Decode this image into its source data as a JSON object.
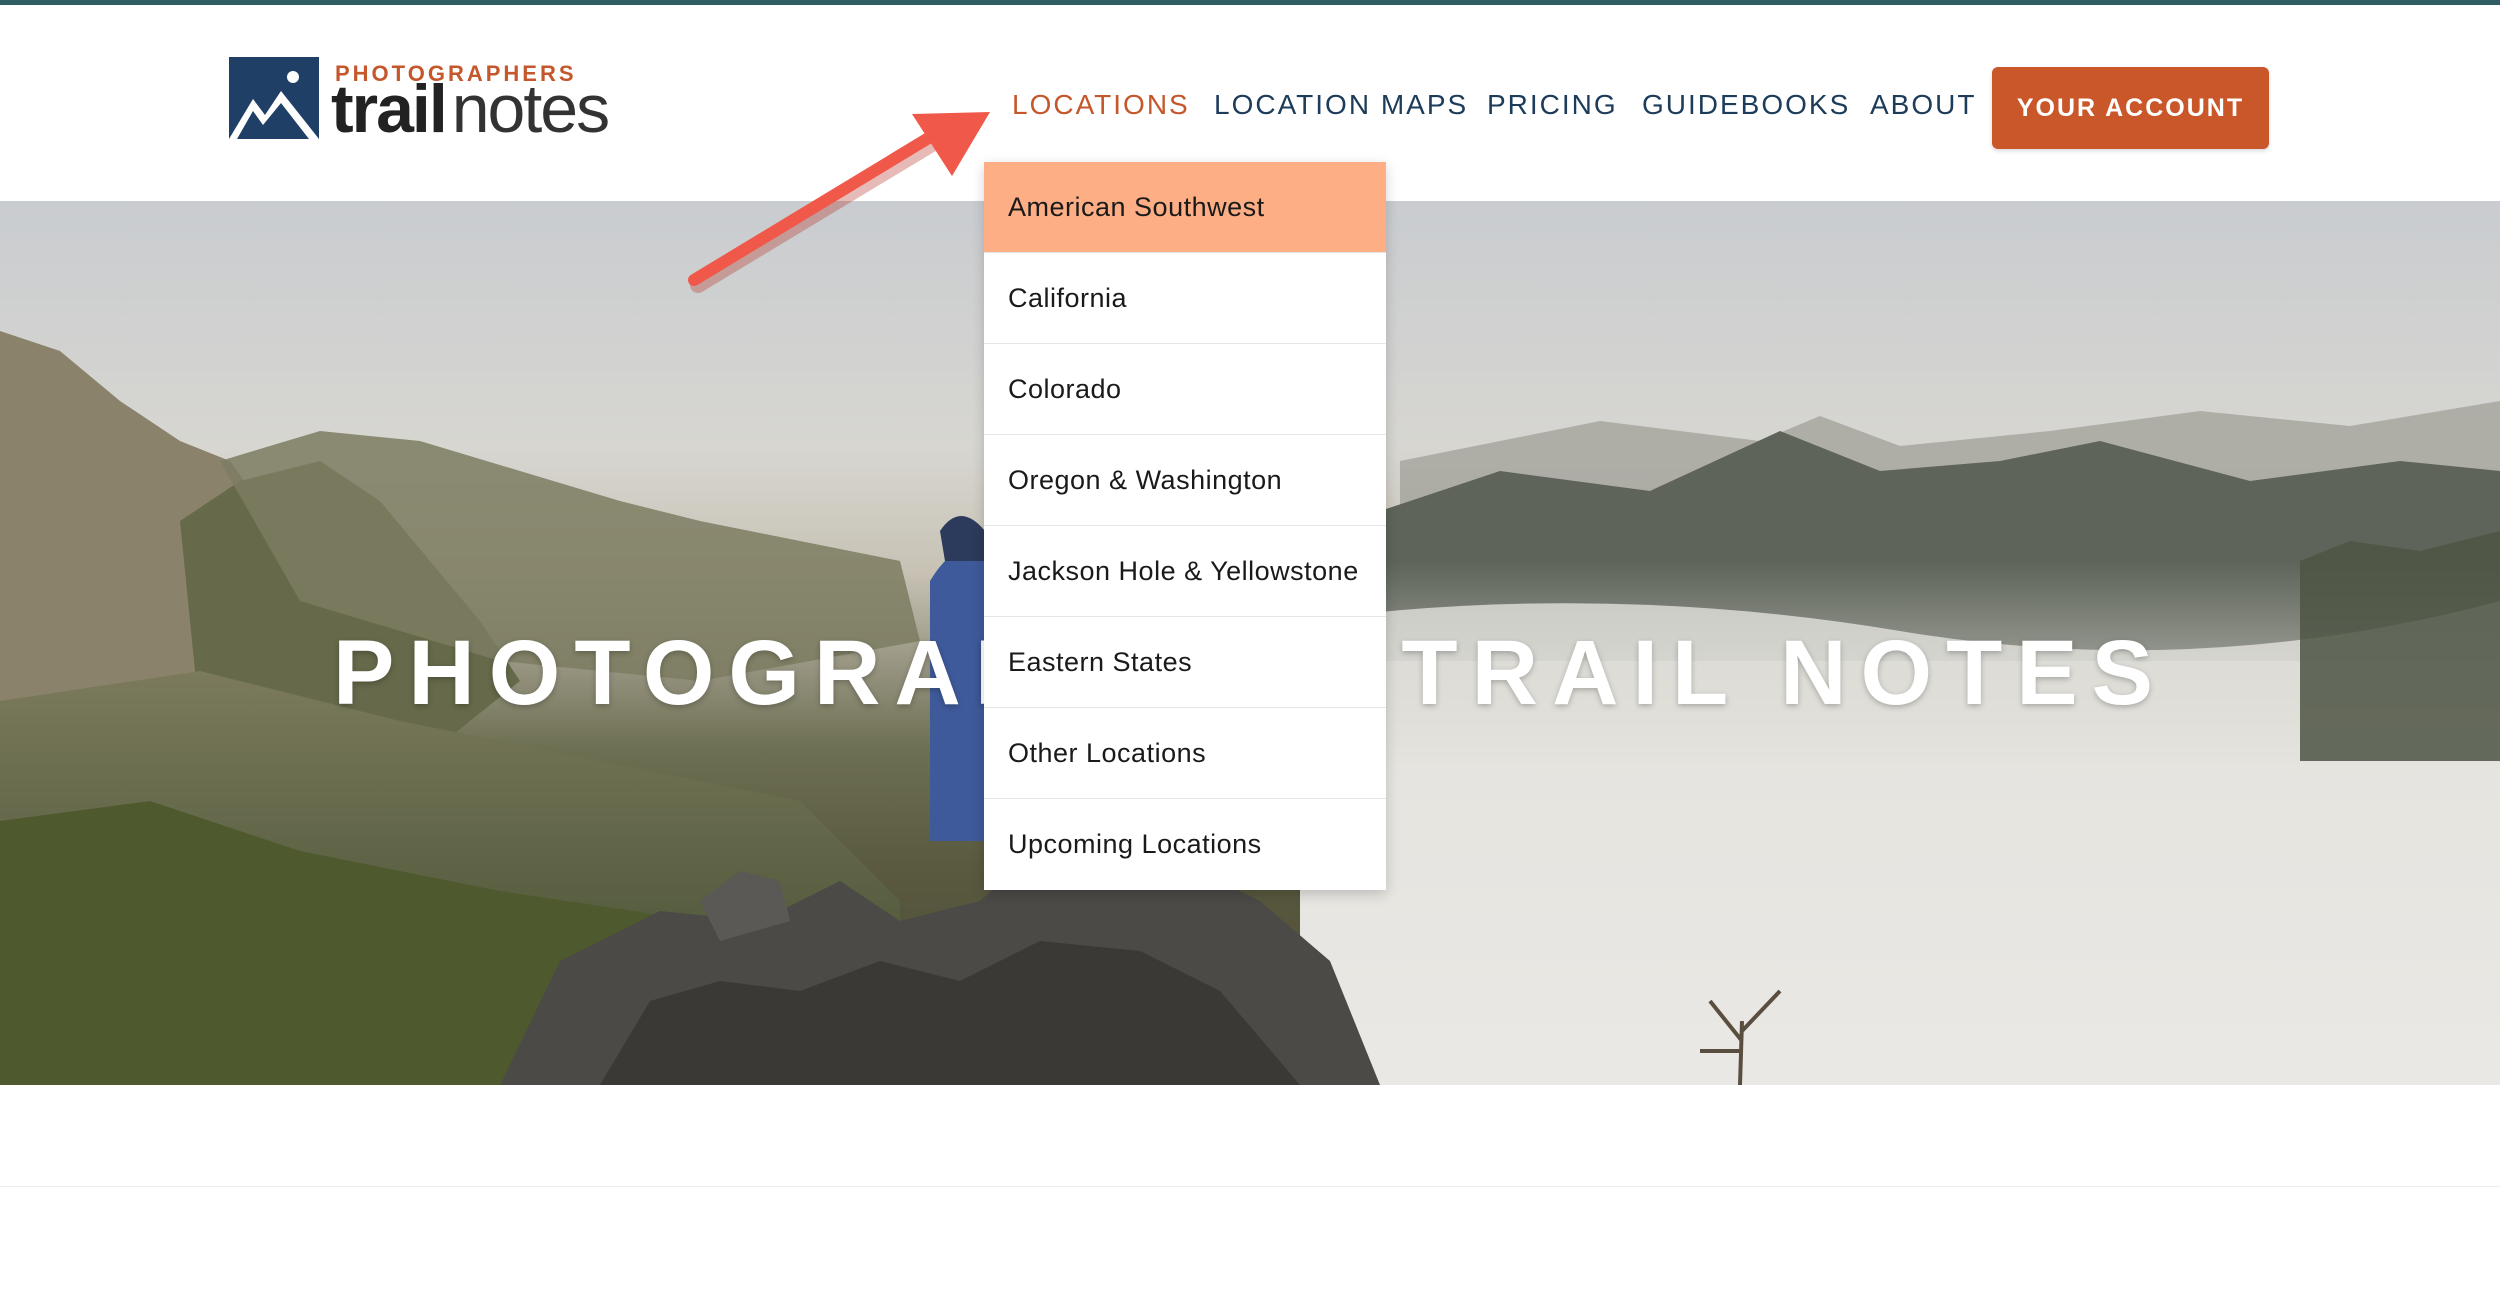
{
  "logo": {
    "top_text": "PHOTOGRAPHERS",
    "word_bold": "trail",
    "word_regular": "notes"
  },
  "nav": {
    "items": [
      {
        "label": "LOCATIONS",
        "active": true
      },
      {
        "label": "LOCATION MAPS",
        "active": false
      },
      {
        "label": "PRICING",
        "active": false
      },
      {
        "label": "GUIDEBOOKS",
        "active": false
      },
      {
        "label": "ABOUT",
        "active": false
      }
    ],
    "account_label": "YOUR ACCOUNT"
  },
  "dropdown": {
    "items": [
      "American Southwest",
      "California",
      "Colorado",
      "Oregon & Washington",
      "Jackson Hole & Yellowstone",
      "Eastern States",
      "Other Locations",
      "Upcoming Locations"
    ]
  },
  "hero": {
    "title": "PHOTOGRAPHERS TRAIL NOTES"
  },
  "colors": {
    "accent": "#c9572a",
    "nav_text": "#1d3c5a",
    "dropdown_highlight": "#fdae85",
    "annotation_arrow": "#f0584a",
    "top_border": "#2f5d63"
  },
  "icons": {
    "logo": "mountain-logo-icon",
    "annotation": "arrow-annotation-icon"
  }
}
